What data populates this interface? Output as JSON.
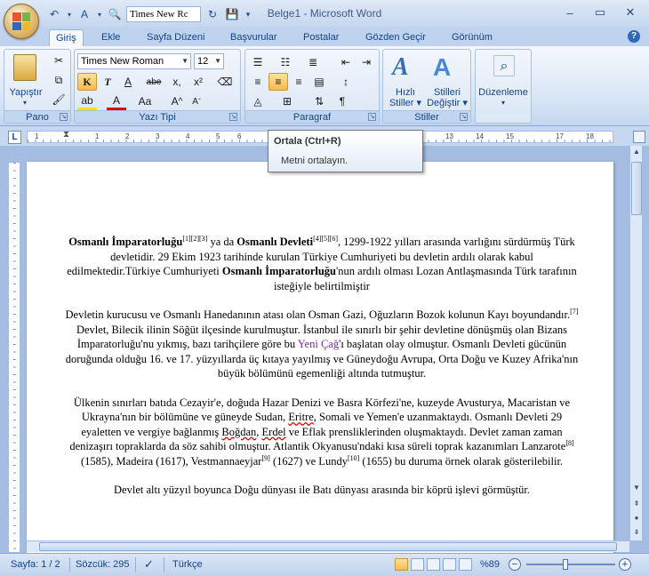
{
  "window": {
    "title": "Belge1 - Microsoft Word",
    "qat_font": "Times New Rc"
  },
  "tabs": [
    {
      "label": "Giriş"
    },
    {
      "label": "Ekle"
    },
    {
      "label": "Sayfa Düzeni"
    },
    {
      "label": "Başvurular"
    },
    {
      "label": "Postalar"
    },
    {
      "label": "Gözden Geçir"
    },
    {
      "label": "Görünüm"
    }
  ],
  "ribbon": {
    "clipboard": {
      "paste_label": "Yapıştır",
      "group_label": "Pano"
    },
    "font": {
      "font_name": "Times New Roman",
      "font_size": "12",
      "group_label": "Yazı Tipi"
    },
    "paragraph": {
      "group_label": "Paragraf"
    },
    "styles": {
      "quick_styles": "Hızlı",
      "quick_styles_2": "Stiller",
      "change_styles": "Stilleri",
      "change_styles_2": "Değiştir",
      "group_label": "Stiller"
    },
    "editing": {
      "label": "Düzenleme"
    }
  },
  "ruler": {
    "numbers": [
      "1",
      "1",
      "2",
      "3",
      "4",
      "5",
      "6",
      "13",
      "14",
      "15",
      "17",
      "18"
    ]
  },
  "tooltip": {
    "title": "Ortala (Ctrl+R)",
    "description": "Metni ortalayın."
  },
  "document": {
    "p1": {
      "a": "Osmanlı İmparatorluğu",
      "a_sup": "[1][2][3]",
      "b": " ya da ",
      "c": "Osmanlı Devleti",
      "c_sup": "[4][5][6]",
      "d": ", 1299-1922 yılları arasında varlığını sürdürmüş Türk devletidir. 29 Ekim 1923 tarihinde kurulan Türkiye Cumhuriyeti bu devletin ardılı olarak kabul edilmektedir.Türkiye Cumhuriyeti ",
      "e": "Osmanlı İmparatorluğu",
      "f": "'nun ardılı olması Lozan Antlaşmasında Türk tarafının isteğiyle belirtilmiştir"
    },
    "p2": {
      "a": "Devletin kurucusu ve Osmanlı Hanedanının atası olan Osman Gazi, Oğuzların Bozok kolunun Kayı boyundandır.",
      "a_sup": "[7]",
      "b": " Devlet, Bilecik ilinin Söğüt ilçesinde kurulmuştur. İstanbul ile sınırlı bir şehir devletine dönüşmüş olan Bizans İmparatorluğu'nu yıkmış, bazı tarihçilere göre bu ",
      "link": "Yeni Çağ",
      "c": "'ı başlatan olay olmuştur. Osmanlı Devleti gücünün doruğunda olduğu 16. ve 17. yüzyıllarda üç kıtaya yayılmış ve Güneydoğu Avrupa, Orta Doğu ve Kuzey Afrika'nın büyük bölümünü egemenliği altında tutmuştur."
    },
    "p3": {
      "a": "Ülkenin sınırları batıda Cezayir'e, doğuda Hazar Denizi ve Basra Körfezi'ne, kuzeyde Avusturya, Macaristan ve Ukrayna'nın bir bölümüne ve güneyde Sudan, ",
      "s1": "Eritre",
      "b": ", Somali ve Yemen'e uzanmaktaydı. Osmanlı Devleti 29 eyaletten ve vergiye bağlanmış ",
      "s2": "Boğdan",
      "c": ", ",
      "s3": "Erdel",
      "d": " ve Eflak prensliklerinden oluşmaktaydı. Devlet zaman zaman denizaşırı topraklarda da söz sahibi olmuştur. Atlantik Okyanusu'ndaki kısa süreli toprak kazanımları Lanzarote",
      "sup1": "[8]",
      "e": " (1585), Madeira (1617), Vestmannaeyjar",
      "sup2": "[9]",
      "f": " (1627) ve Lundy",
      "sup3": "[10]",
      "g": " (1655) bu duruma örnek olarak gösterilebilir."
    },
    "p4": "Devlet altı yüzyıl boyunca Doğu dünyası ile Batı dünyası arasında bir köprü işlevi görmüştür."
  },
  "status": {
    "page": "Sayfa: 1 / 2",
    "words": "Sözcük: 295",
    "language": "Türkçe",
    "zoom": "%89",
    "zoom_percent": 89
  },
  "colors": {
    "accent": "#15428b",
    "link": "#7a2c91"
  }
}
